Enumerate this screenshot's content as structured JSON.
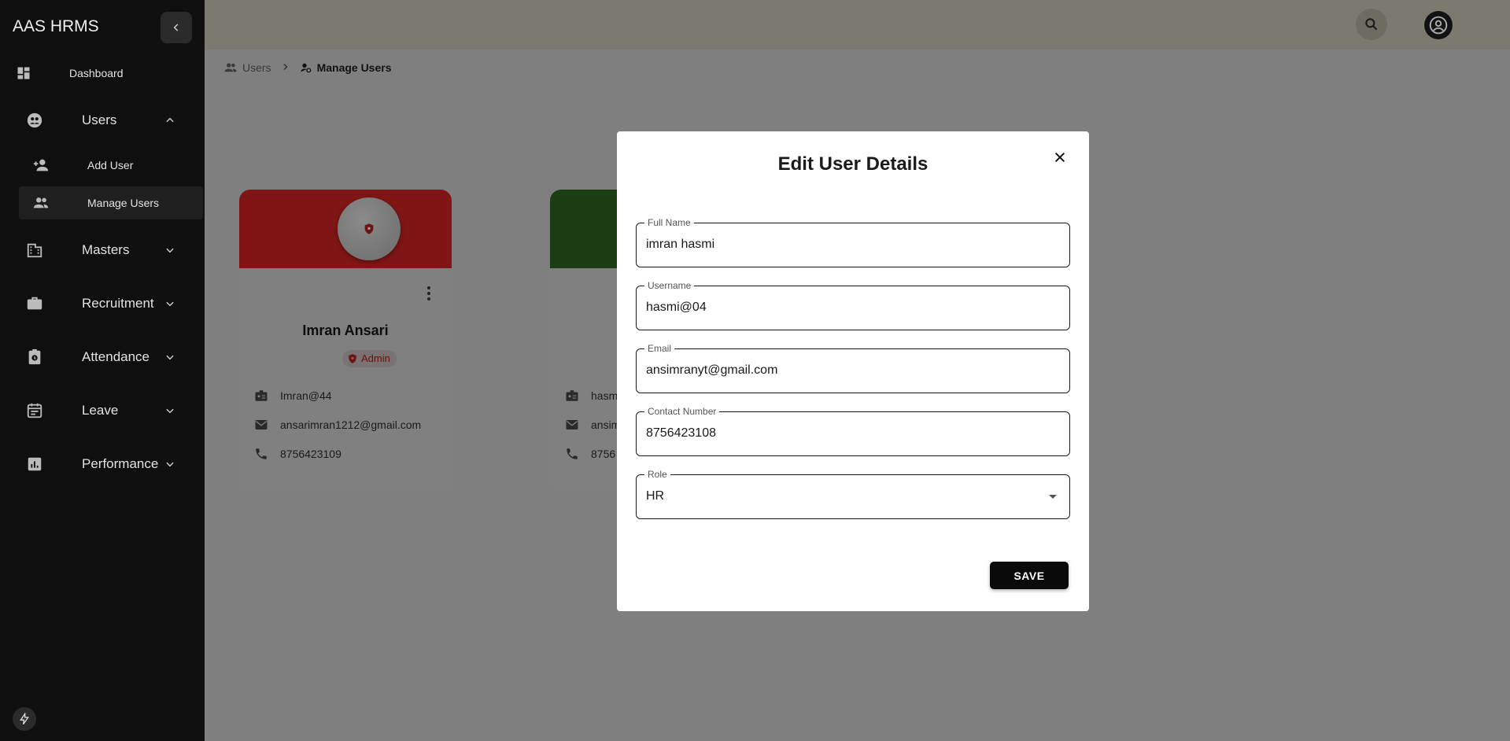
{
  "app": {
    "brand": "AAS HRMS"
  },
  "sidebar": {
    "items": [
      {
        "label": "Dashboard",
        "icon": "dashboard-icon"
      },
      {
        "label": "Users",
        "icon": "users-group-icon",
        "expanded": true,
        "children": [
          {
            "label": "Add User",
            "icon": "person-add-icon"
          },
          {
            "label": "Manage Users",
            "icon": "people-icon",
            "active": true
          }
        ]
      },
      {
        "label": "Masters",
        "icon": "building-icon"
      },
      {
        "label": "Recruitment",
        "icon": "briefcase-icon"
      },
      {
        "label": "Attendance",
        "icon": "clock-badge-icon"
      },
      {
        "label": "Leave",
        "icon": "calendar-icon"
      },
      {
        "label": "Performance",
        "icon": "bar-chart-icon"
      }
    ]
  },
  "breadcrumb": {
    "parent": "Users",
    "current": "Manage Users"
  },
  "page": {
    "title": "Manage Users"
  },
  "cards": [
    {
      "name": "Imran Ansari",
      "role": "Admin",
      "username": "Imran@44",
      "email": "ansarimran1212@gmail.com",
      "phone": "8756423109",
      "header_color": "#7f1515"
    },
    {
      "username": "hasm",
      "email": "ansim",
      "phone": "8756",
      "header_color": "#1a3d14"
    }
  ],
  "modal": {
    "title": "Edit User Details",
    "fields": [
      {
        "label": "Full Name",
        "value": "imran hasmi"
      },
      {
        "label": "Username",
        "value": "hasmi@04"
      },
      {
        "label": "Email",
        "value": "ansimranyt@gmail.com"
      },
      {
        "label": "Contact Number",
        "value": "8756423108"
      },
      {
        "label": "Role",
        "value": "HR"
      }
    ],
    "save_label": "SAVE"
  },
  "colors": {
    "overlay": "#7f7f7f",
    "sidebar": "#0f0f0f",
    "admin_red": "#7f1515",
    "hr_green": "#1a3d14"
  }
}
